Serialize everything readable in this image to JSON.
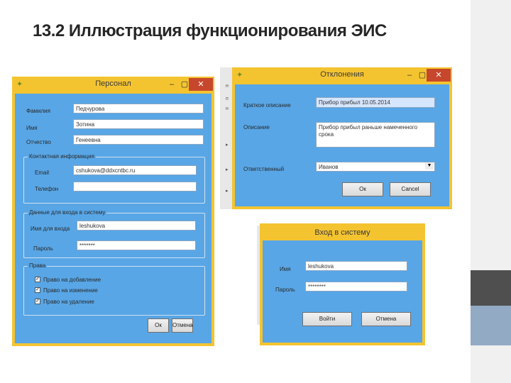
{
  "slide": {
    "title": "13.2 Иллюстрация функционирования ЭИС"
  },
  "window_controls": {
    "minimize": "–",
    "maximize": "▢",
    "close": "✕"
  },
  "personnel": {
    "title": "Персонал",
    "fields": {
      "surname_label": "Фамилия",
      "surname_value": "Педчурова",
      "name_label": "Имя",
      "name_value": "Зотина",
      "patronymic_label": "Отчество",
      "patronymic_value": "Генеевна"
    },
    "contacts": {
      "legend": "Контактная информация",
      "email_label": "Email",
      "email_value": "cshukova@ddxcntbc.ru",
      "phone_label": "Телефон",
      "phone_value": ""
    },
    "login": {
      "legend": "Данные для входа в систему",
      "login_label": "Имя для входа",
      "login_value": "leshukova",
      "password_label": "Пароль",
      "password_value": "*******"
    },
    "rights": {
      "legend": "Права",
      "items": [
        {
          "label": "Право на добавление",
          "checked": true
        },
        {
          "label": "Право на изменение",
          "checked": true
        },
        {
          "label": "Право на удаление",
          "checked": true
        }
      ]
    },
    "buttons": {
      "ok": "Ок",
      "cancel": "Отмена"
    }
  },
  "deviations": {
    "title": "Отклонения",
    "short_label": "Краткое описание",
    "short_value": "Прибор прибыл 10.05.2014",
    "desc_label": "Описание",
    "desc_value": "Прибор прибыл раньше намеченного срока",
    "resp_label": "Ответственный",
    "resp_value": "Иванов",
    "buttons": {
      "ok": "Ок",
      "cancel": "Cancel"
    }
  },
  "login_dialog": {
    "title": "Вход в систему",
    "login_label": "Имя",
    "login_value": "leshukova",
    "password_label": "Пароль",
    "password_value": "********",
    "buttons": {
      "login": "Войти",
      "cancel": "Отмена"
    }
  },
  "colors": {
    "window_frame": "#f4c430",
    "window_body": "#58a6e6",
    "close_button": "#c7472c",
    "sidebar_dark": "#4f4f4f",
    "sidebar_blue": "#92aac3"
  }
}
